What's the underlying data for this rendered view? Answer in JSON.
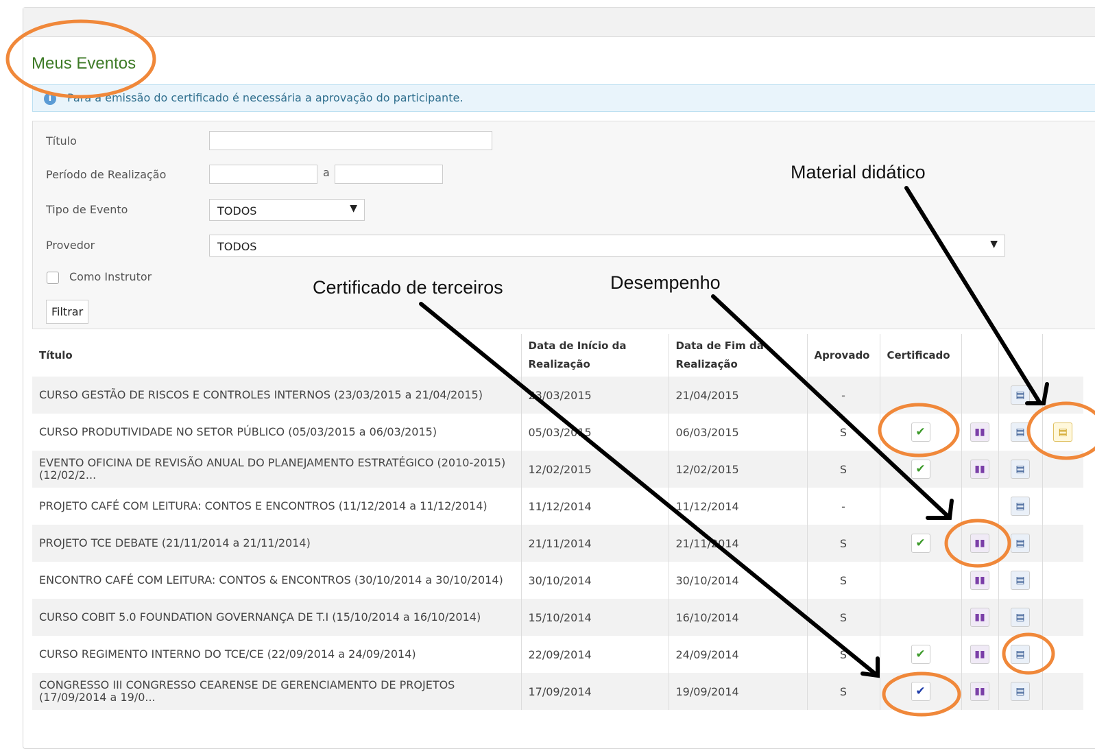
{
  "page": {
    "title": "Meus Eventos",
    "info_message": "Para a emissão do certificado é necessária a aprovação do participante."
  },
  "filters": {
    "titulo_label": "Título",
    "titulo_value": "",
    "periodo_label": "Período de Realização",
    "periodo_sep": "a",
    "periodo_inicio": "",
    "periodo_fim": "",
    "tipo_label": "Tipo de Evento",
    "tipo_selected": "TODOS",
    "provedor_label": "Provedor",
    "provedor_selected": "TODOS",
    "instrutor_label": "Como Instrutor",
    "instrutor_checked": false,
    "filtrar_button": "Filtrar"
  },
  "table": {
    "headers": {
      "titulo": "Título",
      "inicio": "Data de Início da Realização",
      "fim": "Data de Fim da Realização",
      "aprovado": "Aprovado",
      "certificado": "Certificado"
    },
    "rows": [
      {
        "titulo": "CURSO GESTÃO DE RISCOS E CONTROLES INTERNOS (23/03/2015 a 21/04/2015)",
        "inicio": "23/03/2015",
        "fim": "21/04/2015",
        "aprovado": "-",
        "certificado": "",
        "desempenho": false,
        "documento": true,
        "material": false
      },
      {
        "titulo": "CURSO PRODUTIVIDADE NO SETOR PÚBLICO (05/03/2015 a 06/03/2015)",
        "inicio": "05/03/2015",
        "fim": "06/03/2015",
        "aprovado": "S",
        "certificado": "green",
        "desempenho": true,
        "documento": true,
        "material": true
      },
      {
        "titulo": "EVENTO OFICINA DE REVISÃO ANUAL DO PLANEJAMENTO ESTRATÉGICO (2010-2015) (12/02/2...",
        "inicio": "12/02/2015",
        "fim": "12/02/2015",
        "aprovado": "S",
        "certificado": "green",
        "desempenho": true,
        "documento": true,
        "material": false
      },
      {
        "titulo": "PROJETO CAFÉ COM LEITURA: CONTOS E ENCONTROS (11/12/2014 a 11/12/2014)",
        "inicio": "11/12/2014",
        "fim": "11/12/2014",
        "aprovado": "-",
        "certificado": "",
        "desempenho": false,
        "documento": true,
        "material": false
      },
      {
        "titulo": "PROJETO TCE DEBATE (21/11/2014 a 21/11/2014)",
        "inicio": "21/11/2014",
        "fim": "21/11/2014",
        "aprovado": "S",
        "certificado": "green",
        "desempenho": true,
        "documento": true,
        "material": false
      },
      {
        "titulo": "ENCONTRO CAFÉ COM LEITURA: CONTOS & ENCONTROS (30/10/2014 a 30/10/2014)",
        "inicio": "30/10/2014",
        "fim": "30/10/2014",
        "aprovado": "S",
        "certificado": "",
        "desempenho": true,
        "documento": true,
        "material": false
      },
      {
        "titulo": "CURSO COBIT 5.0 FOUNDATION GOVERNANÇA DE T.I (15/10/2014 a 16/10/2014)",
        "inicio": "15/10/2014",
        "fim": "16/10/2014",
        "aprovado": "S",
        "certificado": "",
        "desempenho": true,
        "documento": true,
        "material": false
      },
      {
        "titulo": "CURSO REGIMENTO INTERNO DO TCE/CE (22/09/2014 a 24/09/2014)",
        "inicio": "22/09/2014",
        "fim": "24/09/2014",
        "aprovado": "S",
        "certificado": "green",
        "desempenho": true,
        "documento": true,
        "material": false
      },
      {
        "titulo": "CONGRESSO III CONGRESSO CEARENSE DE GERENCIAMENTO DE PROJETOS (17/09/2014 a 19/0...",
        "inicio": "17/09/2014",
        "fim": "19/09/2014",
        "aprovado": "S",
        "certificado": "blue",
        "desempenho": true,
        "documento": true,
        "material": false
      }
    ]
  },
  "icons": {
    "check": "check-icon",
    "desempenho": "performance-chart-icon",
    "documento": "document-icon",
    "material": "material-didatico-icon"
  },
  "annotations": {
    "material_didatico": "Material didático",
    "desempenho": "Desempenho",
    "certificado_terceiros": "Certificado de terceiros"
  },
  "colors": {
    "title_green": "#3d7a26",
    "info_blue": "#31708f",
    "highlight_orange": "#f0883a",
    "check_green": "#3c9a2a",
    "check_blue": "#1c3aa8"
  }
}
